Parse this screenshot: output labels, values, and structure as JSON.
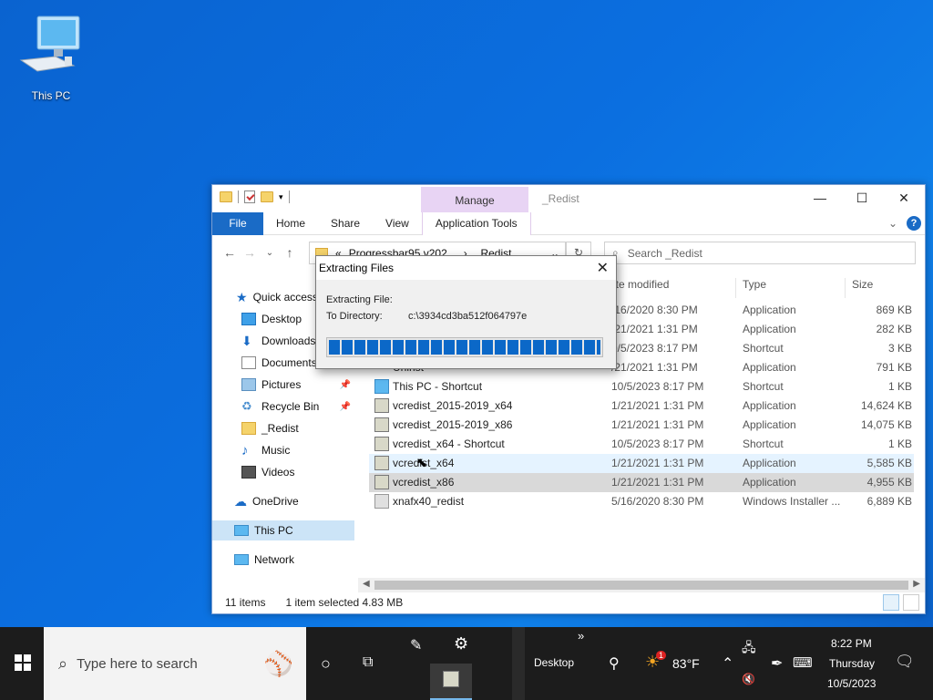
{
  "desktop": {
    "icon_label": "This PC"
  },
  "explorer": {
    "title": "_Redist",
    "manage_label": "Manage",
    "ribbon_tabs": [
      "File",
      "Home",
      "Share",
      "View",
      "Application Tools"
    ],
    "address": {
      "prefix": "«",
      "crumb1": "Progressbar95.v202...",
      "crumb2": "_Redist"
    },
    "search_placeholder": "Search _Redist",
    "sidebar": [
      {
        "label": "Quick access",
        "icon": "star-icon"
      },
      {
        "label": "Desktop",
        "icon": "desktop-folder-icon",
        "pinned": true
      },
      {
        "label": "Downloads",
        "icon": "download-icon",
        "pinned": true
      },
      {
        "label": "Documents",
        "icon": "documents-icon",
        "pinned": true
      },
      {
        "label": "Pictures",
        "icon": "pictures-icon",
        "pinned": true
      },
      {
        "label": "Recycle Bin",
        "icon": "recycle-bin-icon",
        "pinned": true
      },
      {
        "label": "_Redist",
        "icon": "folder-icon"
      },
      {
        "label": "Music",
        "icon": "music-icon"
      },
      {
        "label": "Videos",
        "icon": "videos-icon"
      },
      {
        "label": "OneDrive",
        "icon": "cloud-icon"
      },
      {
        "label": "This PC",
        "icon": "computer-icon",
        "selected": true
      },
      {
        "label": "Network",
        "icon": "network-icon"
      }
    ],
    "columns": {
      "date": "ate modified",
      "type": "Type",
      "size": "Size"
    },
    "files": [
      {
        "name": "",
        "date": "/16/2020 8:30 PM",
        "type": "Application",
        "size": "869 KB"
      },
      {
        "name": "",
        "date": "/21/2021 1:31 PM",
        "type": "Application",
        "size": "282 KB"
      },
      {
        "name": "",
        "date": "0/5/2023 8:17 PM",
        "type": "Shortcut",
        "size": "3 KB"
      },
      {
        "name": "Uninst",
        "date": "/21/2021 1:31 PM",
        "type": "Application",
        "size": "791 KB"
      },
      {
        "name": "This PC - Shortcut",
        "date": "10/5/2023 8:17 PM",
        "type": "Shortcut",
        "size": "1 KB"
      },
      {
        "name": "vcredist_2015-2019_x64",
        "date": "1/21/2021 1:31 PM",
        "type": "Application",
        "size": "14,624 KB"
      },
      {
        "name": "vcredist_2015-2019_x86",
        "date": "1/21/2021 1:31 PM",
        "type": "Application",
        "size": "14,075 KB"
      },
      {
        "name": "vcredist_x64 - Shortcut",
        "date": "10/5/2023 8:17 PM",
        "type": "Shortcut",
        "size": "1 KB"
      },
      {
        "name": "vcredist_x64",
        "date": "1/21/2021 1:31 PM",
        "type": "Application",
        "size": "5,585 KB"
      },
      {
        "name": "vcredist_x86",
        "date": "1/21/2021 1:31 PM",
        "type": "Application",
        "size": "4,955 KB"
      },
      {
        "name": "xnafx40_redist",
        "date": "5/16/2020 8:30 PM",
        "type": "Windows Installer ...",
        "size": "6,889 KB"
      }
    ],
    "status": {
      "items": "11 items",
      "selected": "1 item selected  4.83 MB"
    }
  },
  "dialog": {
    "title": "Extracting Files",
    "extracting_label": "Extracting File:",
    "directory_label": "To Directory:",
    "directory_value": "c:\\3934cd3ba512f064797e",
    "progress_percent": 100
  },
  "taskbar": {
    "search_placeholder": "Type here to search",
    "desktop_label": "Desktop",
    "weather_temp": "83°F",
    "weather_badge": "1",
    "time": "8:22 PM",
    "day": "Thursday",
    "date": "10/5/2023",
    "chevrons": "»"
  }
}
